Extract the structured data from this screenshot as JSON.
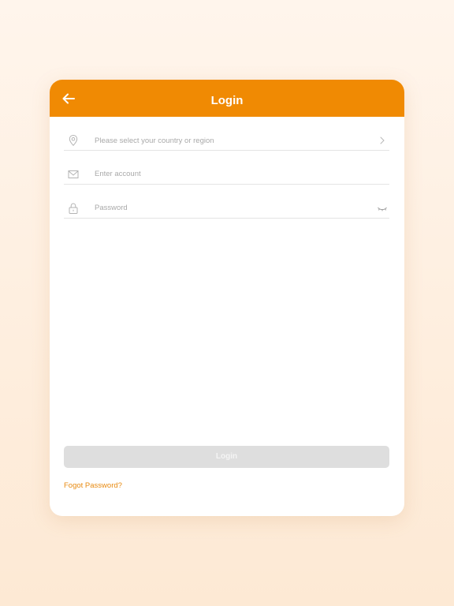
{
  "header": {
    "title": "Login",
    "back_icon": "arrow-left-icon",
    "color": "#f08a03"
  },
  "form": {
    "region": {
      "placeholder": "Please select your country or region",
      "icon": "location-pin-icon",
      "trailing_icon": "chevron-right-icon"
    },
    "account": {
      "placeholder": "Enter account",
      "icon": "envelope-icon"
    },
    "password": {
      "placeholder": "Password",
      "icon": "lock-icon",
      "trailing_icon": "eye-closed-icon"
    }
  },
  "login_button": {
    "label": "Login",
    "state": "disabled"
  },
  "forgot_password": {
    "label": "Fogot Password?",
    "color": "#e88a10"
  }
}
